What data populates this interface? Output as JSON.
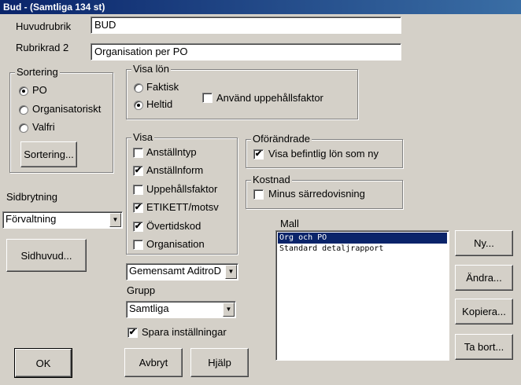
{
  "window": {
    "title": "Bud - (Samtliga 134 st)"
  },
  "fields": {
    "huvudrubrik_label": "Huvudrubrik",
    "huvudrubrik_value": "BUD",
    "rubrikrad2_label": "Rubrikrad 2",
    "rubrikrad2_value": "Organisation per PO"
  },
  "sortering": {
    "title": "Sortering",
    "options": [
      "PO",
      "Organisatoriskt",
      "Valfri"
    ],
    "selected": "PO",
    "button": "Sortering..."
  },
  "visa_lon": {
    "title": "Visa lön",
    "options": [
      "Faktisk",
      "Heltid"
    ],
    "selected": "Heltid",
    "uppehall_label": "Använd uppehållsfaktor",
    "uppehall_checked": false
  },
  "visa": {
    "title": "Visa",
    "items": [
      {
        "label": "Anställntyp",
        "checked": false
      },
      {
        "label": "Anställnform",
        "checked": true
      },
      {
        "label": "Uppehållsfaktor",
        "checked": false
      },
      {
        "label": "ETIKETT/motsv",
        "checked": true
      },
      {
        "label": "Övertidskod",
        "checked": true
      },
      {
        "label": "Organisation",
        "checked": false
      }
    ]
  },
  "oforandrade": {
    "title": "Oförändrade",
    "label": "Visa befintlig lön som ny",
    "checked": true
  },
  "kostnad": {
    "title": "Kostnad",
    "label": "Minus särredovisning",
    "checked": false
  },
  "sidbrytning": {
    "label": "Sidbrytning",
    "value": "Förvaltning"
  },
  "sidhuvud_button": "Sidhuvud...",
  "gemensamt": {
    "value": "Gemensamt AditroD"
  },
  "grupp": {
    "label": "Grupp",
    "value": "Samtliga"
  },
  "spara": {
    "label": "Spara inställningar",
    "checked": true
  },
  "mall": {
    "label": "Mall",
    "items": [
      "Org och PO",
      "Standard detaljrapport"
    ],
    "selected_index": 0
  },
  "buttons": {
    "ny": "Ny...",
    "andra": "Ändra...",
    "kopiera": "Kopiera...",
    "ta_bort": "Ta bort...",
    "ok": "OK",
    "avbryt": "Avbryt",
    "hjalp": "Hjälp"
  },
  "glyphs": {
    "check": "✔",
    "down_arrow": "▼"
  }
}
